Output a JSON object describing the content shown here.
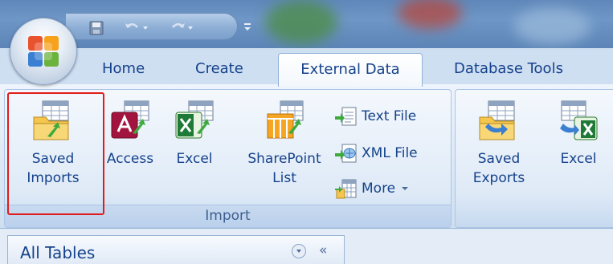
{
  "quick_access": {
    "save_icon": "save-icon",
    "undo_icon": "undo-icon",
    "redo_icon": "redo-icon",
    "customize_icon": "customize-icon"
  },
  "tabs": [
    {
      "label": "Home"
    },
    {
      "label": "Create"
    },
    {
      "label": "External Data",
      "active": true
    },
    {
      "label": "Database Tools"
    }
  ],
  "import_group": {
    "label": "Import",
    "saved_imports": "Saved Imports",
    "access": "Access",
    "excel": "Excel",
    "sharepoint": "SharePoint List",
    "text_file": "Text File",
    "xml_file": "XML File",
    "more": "More"
  },
  "export_group": {
    "saved_exports": "Saved Exports",
    "excel": "Excel"
  },
  "nav_pane": {
    "title": "All Tables"
  },
  "colors": {
    "accent_text": "#15428b",
    "highlight": "#e11b1b",
    "ribbon": "#dfeaf7"
  }
}
